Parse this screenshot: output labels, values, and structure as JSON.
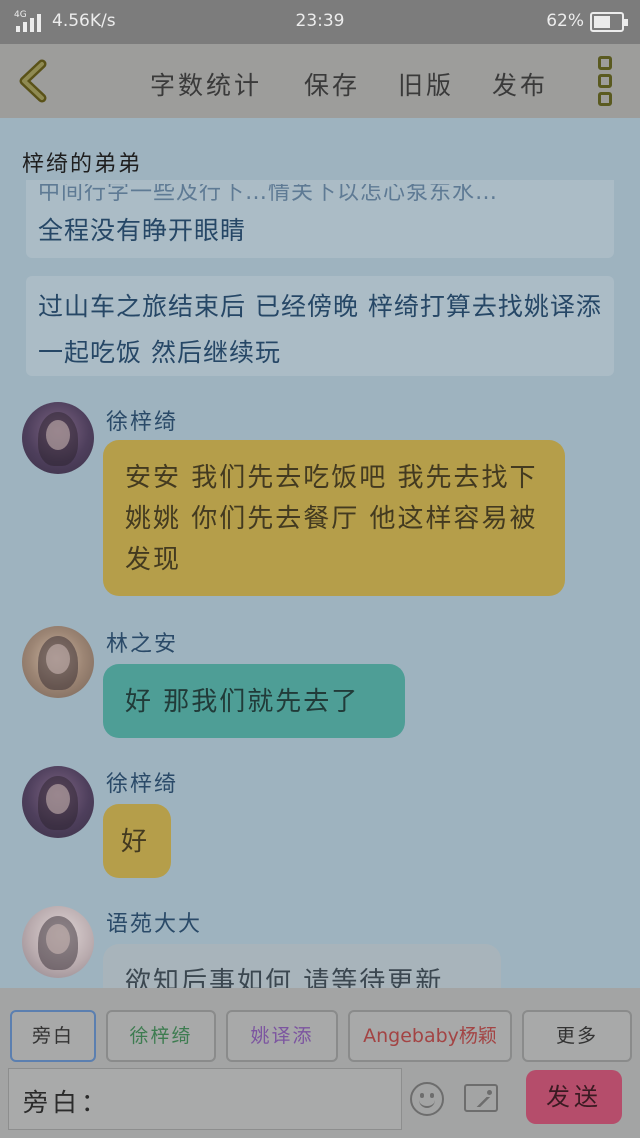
{
  "status_bar": {
    "network_type": "4G",
    "net_speed": "4.56K/s",
    "time": "23:39",
    "battery_percent": "62%",
    "battery_level": 0.62
  },
  "toolbar": {
    "actions": [
      "字数统计",
      "保存",
      "旧版",
      "发布"
    ]
  },
  "book_title": "梓绮的弟弟",
  "chat": {
    "narrations": [
      {
        "faded_line": "中间行字一些及行下…情关下以怎心泵东水…",
        "text": "全程没有睁开眼睛"
      },
      {
        "text": "过山车之旅结束后 已经傍晚 梓绮打算去找姚译添一起吃饭 然后继续玩"
      }
    ],
    "messages": [
      {
        "name": "徐梓绮",
        "text": "安安 我们先去吃饭吧 我先去找下姚姚 你们先去餐厅 他这样容易被发现",
        "color": "#b59e4a"
      },
      {
        "name": "林之安",
        "text": "好 那我们就先去了",
        "color": "#4e9e96"
      },
      {
        "name": "徐梓绮",
        "text": "好",
        "color": "#b59e4a"
      },
      {
        "name": "语苑大大",
        "text": "欲知后事如何 请等待更新",
        "color": "#a8b4bb"
      }
    ]
  },
  "characters": [
    "旁白",
    "徐梓绮",
    "姚译添",
    "Angebaby杨颖",
    "更多"
  ],
  "composer": {
    "prefix": "旁白：",
    "send_label": "发送"
  }
}
